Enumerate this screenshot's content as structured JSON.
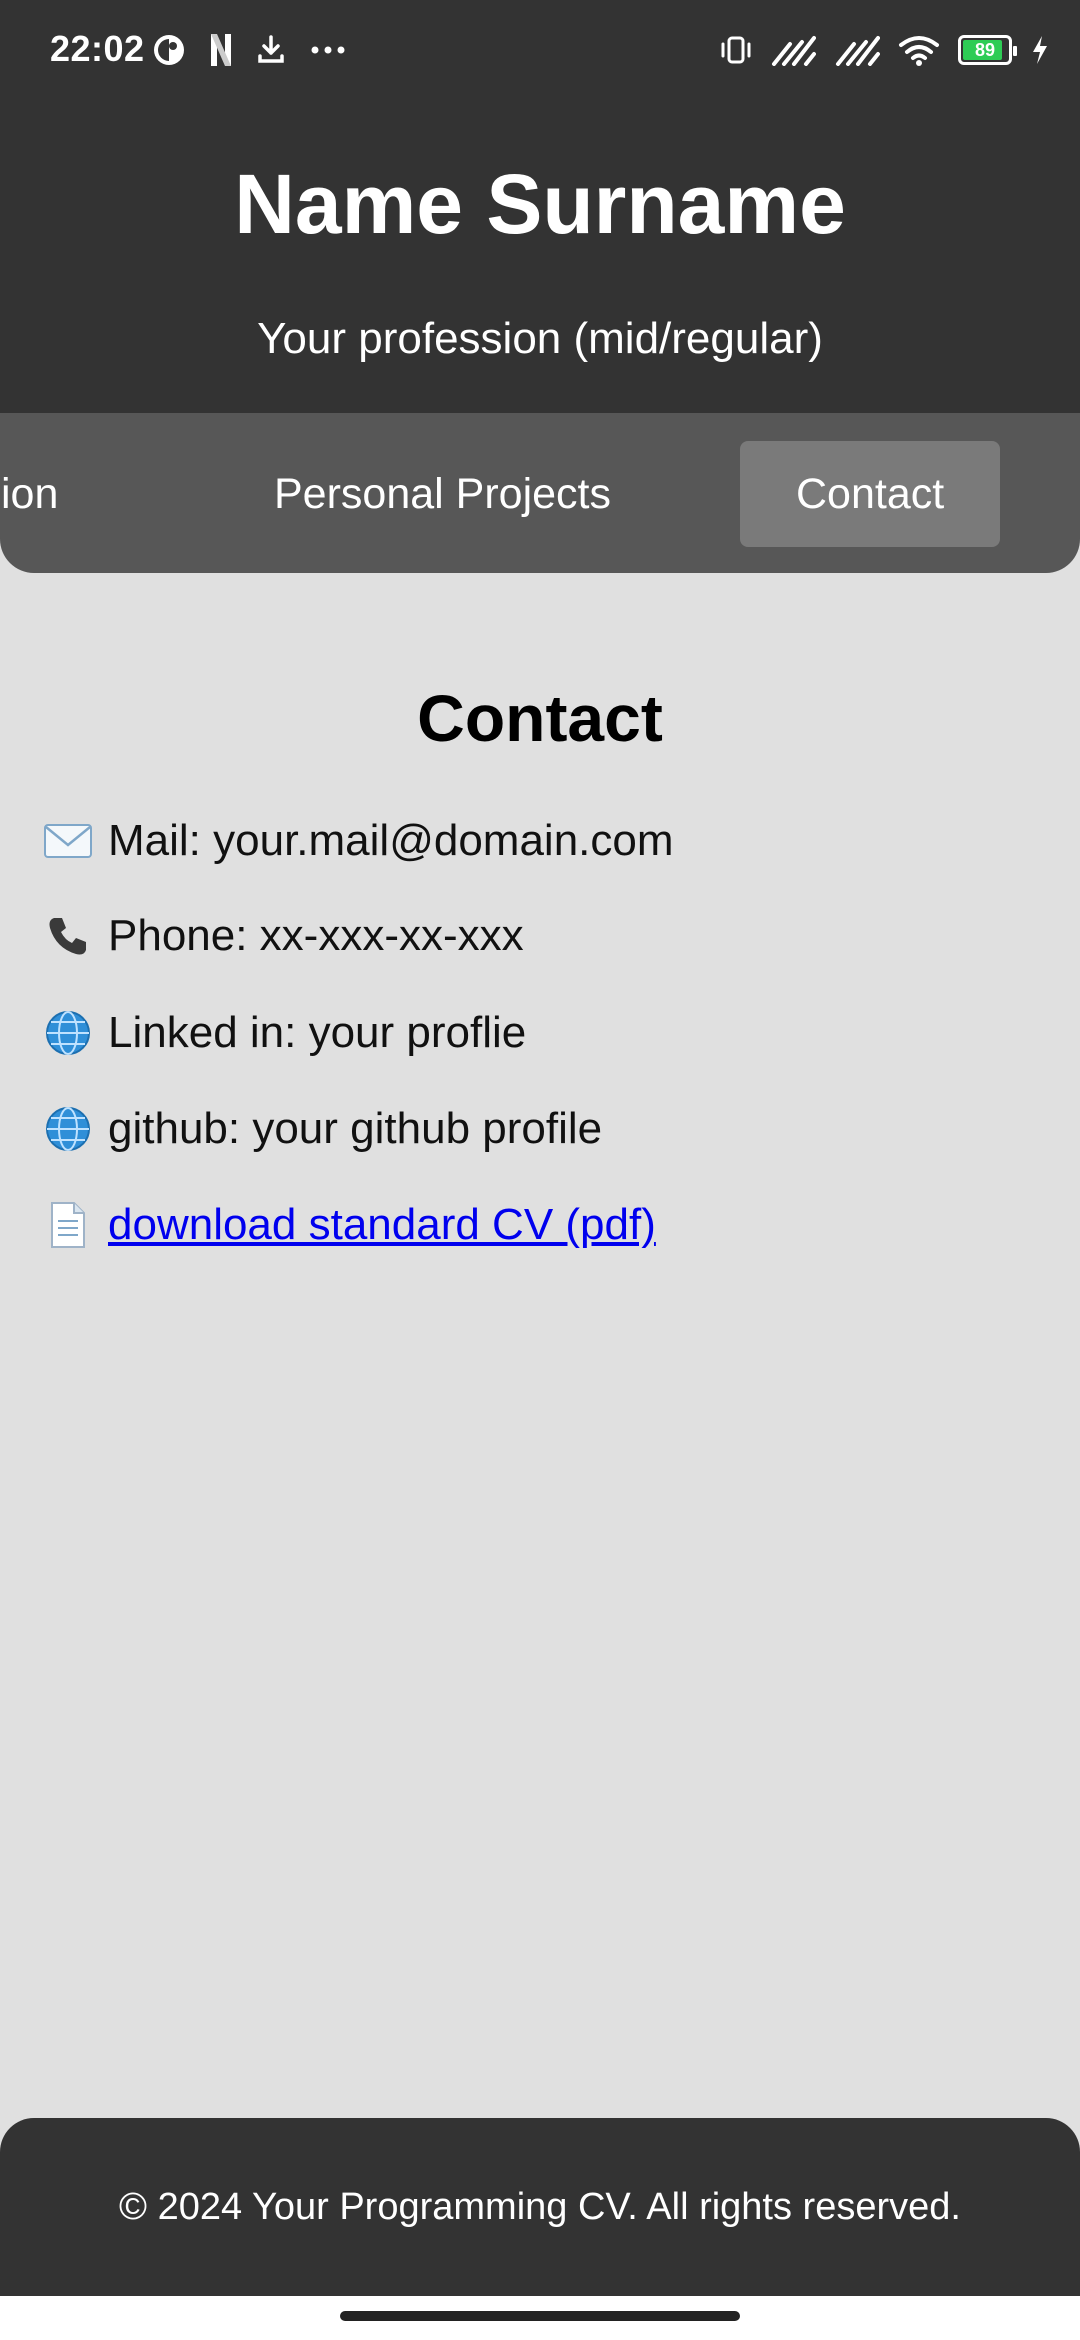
{
  "status_bar": {
    "time": "22:02",
    "left_icons": [
      "app-c-icon",
      "netflix-n-icon",
      "download-icon",
      "more-dots-icon"
    ],
    "right_icons": [
      "vibrate-icon",
      "signal-icon",
      "signal-icon",
      "wifi-icon",
      "battery-icon",
      "charging-icon"
    ],
    "battery_level": "89",
    "battery_color": "#2ecc55"
  },
  "header": {
    "name": "Name Surname",
    "profession": "Your profession (mid/regular)"
  },
  "nav": {
    "items": [
      {
        "label": "ion",
        "active": false
      },
      {
        "label": "Personal Projects",
        "active": false
      },
      {
        "label": "Contact",
        "active": true
      }
    ]
  },
  "contact": {
    "title": "Contact",
    "lines": [
      {
        "icon": "envelope-icon",
        "text": "Mail: your.mail@domain.com"
      },
      {
        "icon": "phone-icon",
        "text": "Phone: xx-xxx-xx-xxx"
      },
      {
        "icon": "globe-icon",
        "text": "Linked in: your proflie"
      },
      {
        "icon": "globe-icon",
        "text": "github: your github profile"
      },
      {
        "icon": "document-icon",
        "text": " download standard CV (pdf)",
        "link": true
      }
    ]
  },
  "footer": {
    "text": "© 2024 Your Programming CV. All rights reserved."
  },
  "colors": {
    "header_bg": "#333333",
    "nav_bg": "#575757",
    "nav_active_bg": "#7a7a7a",
    "page_bg": "#e0e0e0",
    "link": "#0000ee"
  }
}
